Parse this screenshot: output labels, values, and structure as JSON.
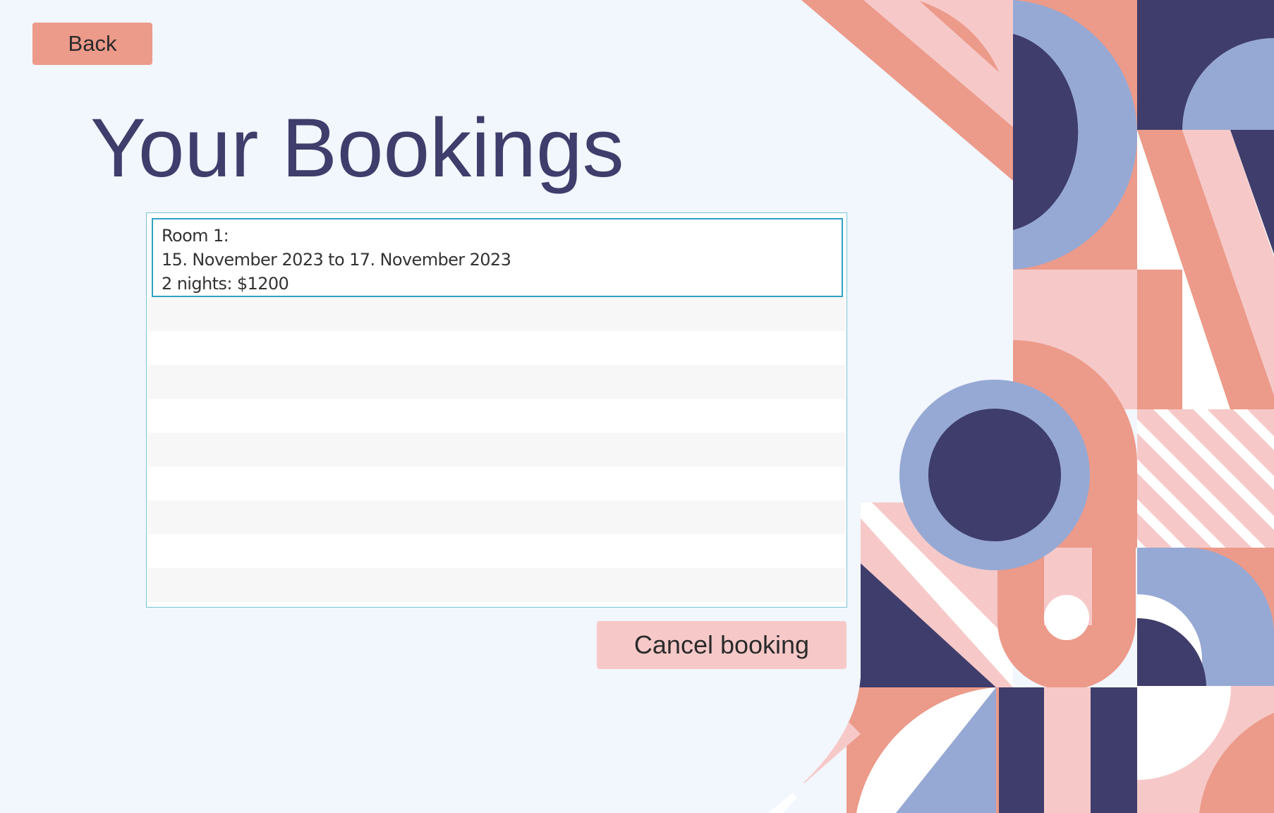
{
  "header": {
    "back_label": "Back",
    "title": "Your Bookings"
  },
  "bookings": [
    {
      "room": "Room 1:",
      "dates": "15. November 2023 to 17. November 2023",
      "summary": "2 nights: $1200"
    }
  ],
  "actions": {
    "cancel_label": "Cancel booking"
  },
  "colors": {
    "background": "#f2f6fd",
    "navy": "#3f3d6b",
    "salmon": "#ec9a8a",
    "pink": "#f6c9c8",
    "periwinkle": "#96a9d4",
    "teal_border": "#2fa2c3"
  }
}
